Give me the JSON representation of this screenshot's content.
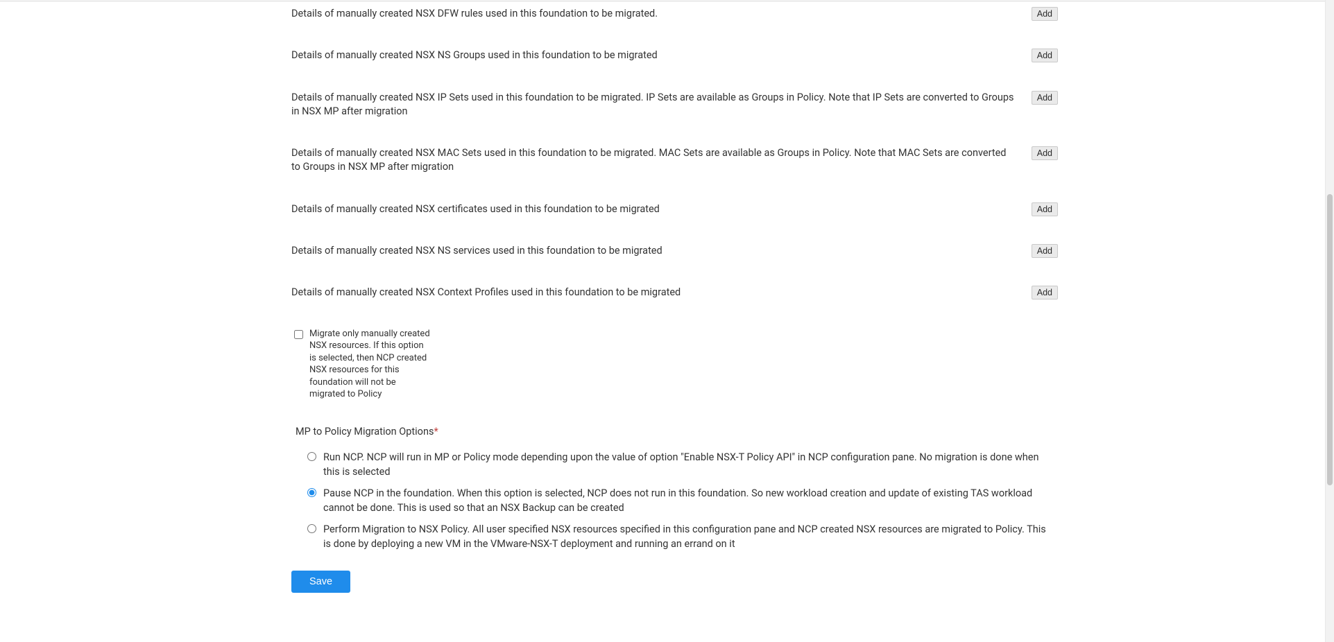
{
  "rows": [
    {
      "label": "Details of manually created NSX DFW rules used in this foundation to be migrated.",
      "add": "Add"
    },
    {
      "label": "Details of manually created NSX NS Groups used in this foundation to be migrated",
      "add": "Add"
    },
    {
      "label": "Details of manually created NSX IP Sets used in this foundation to be migrated. IP Sets are available as Groups in Policy. Note that IP Sets are converted to Groups in NSX MP after migration",
      "add": "Add"
    },
    {
      "label": "Details of manually created NSX MAC Sets used in this foundation to be migrated. MAC Sets are available as Groups in Policy. Note that MAC Sets are converted to Groups in NSX MP after migration",
      "add": "Add"
    },
    {
      "label": "Details of manually created NSX certificates used in this foundation to be migrated",
      "add": "Add"
    },
    {
      "label": "Details of manually created NSX NS services used in this foundation to be migrated",
      "add": "Add"
    },
    {
      "label": "Details of manually created NSX Context Profiles used in this foundation to be migrated",
      "add": "Add"
    }
  ],
  "checkbox": {
    "label": "Migrate only manually created NSX resources. If this option is selected, then NCP created NSX resources for this foundation will not be migrated to Policy",
    "checked": false
  },
  "section": {
    "heading": "MP to Policy Migration Options",
    "required_mark": "*"
  },
  "radios": [
    {
      "value": "run_ncp",
      "label": "Run NCP. NCP will run in MP or Policy mode depending upon the value of option \"Enable NSX-T Policy API\" in NCP configuration pane. No migration is done when this is selected"
    },
    {
      "value": "pause_ncp",
      "label": "Pause NCP in the foundation. When this option is selected, NCP does not run in this foundation. So new workload creation and update of existing TAS workload cannot be done. This is used so that an NSX Backup can be created"
    },
    {
      "value": "perform_migration",
      "label": "Perform Migration to NSX Policy. All user specified NSX resources specified in this configuration pane and NCP created NSX resources are migrated to Policy. This is done by deploying a new VM in the VMware-NSX-T deployment and running an errand on it"
    }
  ],
  "selected_radio": "pause_ncp",
  "buttons": {
    "save": "Save"
  }
}
